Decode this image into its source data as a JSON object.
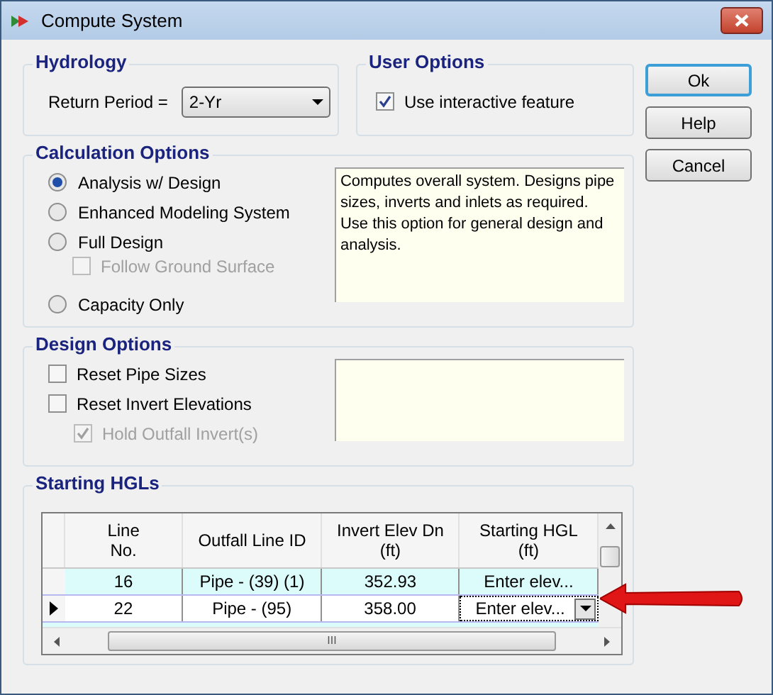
{
  "window": {
    "title": "Compute System"
  },
  "hydrology": {
    "title": "Hydrology",
    "label": "Return Period =",
    "value": "2-Yr"
  },
  "user_options": {
    "title": "User Options",
    "options": [
      {
        "label": "Use interactive feature",
        "checked": true,
        "disabled": false
      }
    ]
  },
  "calculation_options": {
    "title": "Calculation Options",
    "options": [
      {
        "label": "Analysis w/ Design",
        "selected": true
      },
      {
        "label": "Enhanced Modeling System",
        "selected": false
      },
      {
        "label": "Full Design",
        "selected": false,
        "children": [
          {
            "label": "Follow Ground Surface",
            "checked": false,
            "disabled": true
          }
        ]
      },
      {
        "label": "Capacity Only",
        "selected": false
      }
    ],
    "description": "Computes overall system. Designs pipe sizes, inverts and inlets as required. Use this option for general design and analysis."
  },
  "design_options": {
    "title": "Design Options",
    "options": [
      {
        "label": "Reset Pipe Sizes",
        "checked": false,
        "disabled": false
      },
      {
        "label": "Reset Invert Elevations",
        "checked": false,
        "disabled": false,
        "children": [
          {
            "label": "Hold Outfall Invert(s)",
            "checked": true,
            "disabled": true
          }
        ]
      }
    ]
  },
  "starting_hgls": {
    "title": "Starting HGLs",
    "columns": [
      "Line\nNo.",
      "Outfall Line ID",
      "Invert Elev Dn\n(ft)",
      "Starting HGL\n(ft)"
    ],
    "rows": [
      {
        "cells": [
          "16",
          "Pipe - (39) (1)",
          "352.93",
          "Enter elev..."
        ],
        "selected": false
      },
      {
        "cells": [
          "22",
          "Pipe - (95)",
          "358.00",
          "Enter elev..."
        ],
        "selected": true
      }
    ],
    "scroll_grip": "III"
  },
  "buttons": [
    {
      "label": "Ok",
      "default": true
    },
    {
      "label": "Help",
      "default": false
    },
    {
      "label": "Cancel",
      "default": false
    }
  ]
}
